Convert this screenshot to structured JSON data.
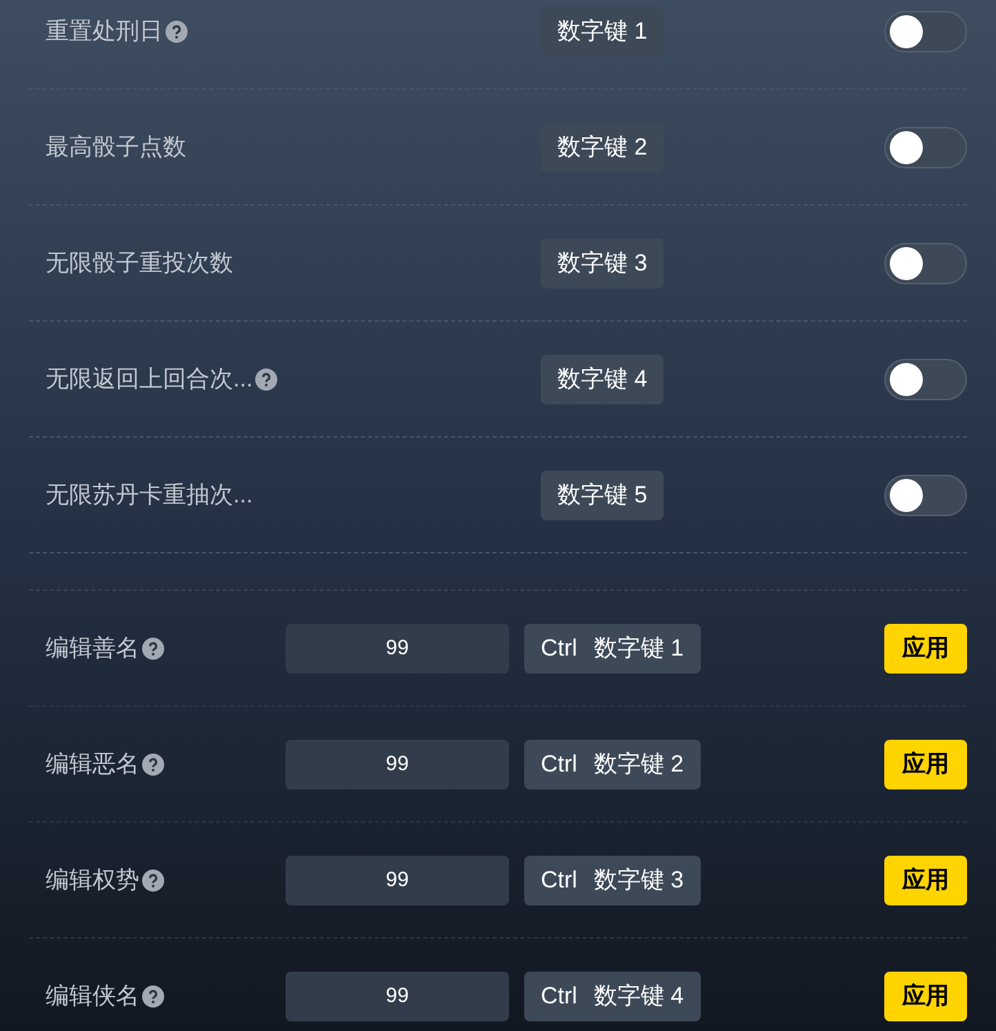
{
  "toggle_rows": [
    {
      "label": "重置处刑日",
      "help": true,
      "keys": [
        "数字键 1"
      ],
      "on": false
    },
    {
      "label": "最高骰子点数",
      "help": false,
      "keys": [
        "数字键 2"
      ],
      "on": false
    },
    {
      "label": "无限骰子重投次数",
      "help": false,
      "keys": [
        "数字键 3"
      ],
      "on": false
    },
    {
      "label": "无限返回上回合次...",
      "help": true,
      "keys": [
        "数字键 4"
      ],
      "on": false
    },
    {
      "label": "无限苏丹卡重抽次...",
      "help": false,
      "keys": [
        "数字键 5"
      ],
      "on": false
    }
  ],
  "edit_rows": [
    {
      "label": "编辑善名",
      "help": true,
      "value": "99",
      "keys": [
        "Ctrl",
        "数字键 1"
      ],
      "button": "应用"
    },
    {
      "label": "编辑恶名",
      "help": true,
      "value": "99",
      "keys": [
        "Ctrl",
        "数字键 2"
      ],
      "button": "应用"
    },
    {
      "label": "编辑权势",
      "help": true,
      "value": "99",
      "keys": [
        "Ctrl",
        "数字键 3"
      ],
      "button": "应用"
    },
    {
      "label": "编辑侠名",
      "help": true,
      "value": "99",
      "keys": [
        "Ctrl",
        "数字键 4"
      ],
      "button": "应用"
    }
  ]
}
